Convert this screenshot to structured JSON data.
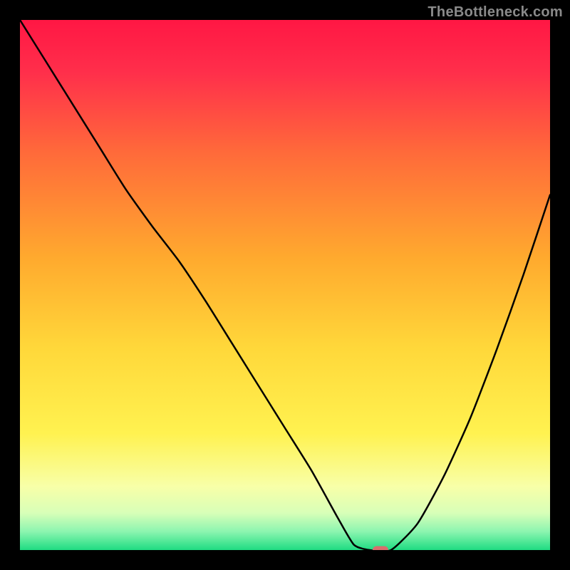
{
  "watermark": "TheBottleneck.com",
  "chart_data": {
    "type": "line",
    "title": "",
    "xlabel": "",
    "ylabel": "",
    "xlim": [
      0,
      100
    ],
    "ylim": [
      0,
      100
    ],
    "grid": false,
    "legend": false,
    "series": [
      {
        "name": "bottleneck-curve",
        "x": [
          0,
          5,
          10,
          15,
          20,
          25,
          30,
          35,
          40,
          45,
          50,
          55,
          60,
          63,
          66,
          70,
          75,
          80,
          85,
          90,
          95,
          100
        ],
        "y": [
          100,
          92,
          84,
          76,
          68,
          61,
          54.5,
          47,
          39,
          31,
          23,
          15,
          6,
          1,
          0,
          0,
          5,
          14,
          25,
          38,
          52,
          67
        ],
        "color": "#000000"
      }
    ],
    "marker": {
      "x": 68,
      "y": 0,
      "color": "#d96d6d"
    },
    "background_gradient": [
      {
        "stop": 0.0,
        "color": "#ff1744"
      },
      {
        "stop": 0.1,
        "color": "#ff2f4b"
      },
      {
        "stop": 0.25,
        "color": "#ff6a3a"
      },
      {
        "stop": 0.45,
        "color": "#ffaa2e"
      },
      {
        "stop": 0.62,
        "color": "#ffd83a"
      },
      {
        "stop": 0.78,
        "color": "#fff250"
      },
      {
        "stop": 0.88,
        "color": "#f8ffa8"
      },
      {
        "stop": 0.93,
        "color": "#d8ffb8"
      },
      {
        "stop": 0.965,
        "color": "#8cf5b0"
      },
      {
        "stop": 1.0,
        "color": "#1fdc82"
      }
    ]
  }
}
